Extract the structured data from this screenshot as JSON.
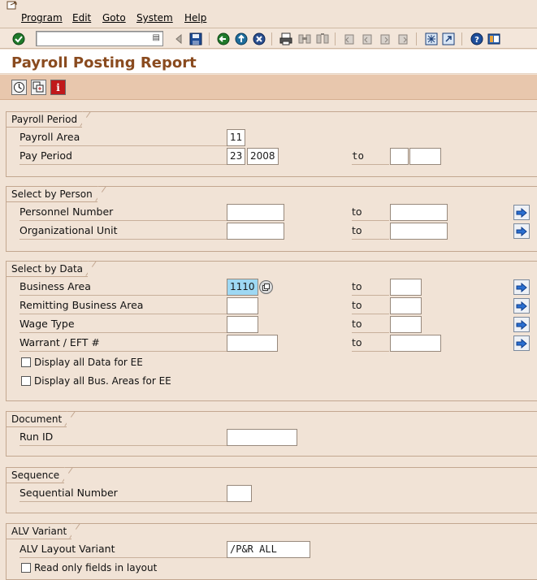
{
  "menu": [
    "Program",
    "Edit",
    "Goto",
    "System",
    "Help"
  ],
  "toolbar": {
    "command_field_value": "",
    "icons": [
      "enter-icon",
      "back-icon",
      "save-icon",
      "back-green-icon",
      "exit-icon",
      "cancel-icon",
      "print-icon",
      "find-icon",
      "find-next-icon",
      "first-page-icon",
      "prev-page-icon",
      "next-page-icon",
      "last-page-icon",
      "create-session-icon",
      "shortcut-icon",
      "help-icon",
      "layout-icon"
    ]
  },
  "page_title": "Payroll Posting Report",
  "app_toolbar": {
    "icons": [
      "execute-icon",
      "get-variant-icon",
      "info-icon"
    ]
  },
  "groups": {
    "payroll_period": {
      "title": "Payroll Period",
      "payroll_area_label": "Payroll Area",
      "payroll_area_value": "11",
      "pay_period_label": "Pay Period",
      "pay_period_value": "23",
      "pay_year_value": "2008",
      "to_label": "to",
      "to_period_value": "",
      "to_year_value": ""
    },
    "select_by_person": {
      "title": "Select by Person",
      "personnel_number_label": "Personnel Number",
      "personnel_number_from": "",
      "personnel_number_to": "",
      "org_unit_label": "Organizational Unit",
      "org_unit_from": "",
      "org_unit_to": "",
      "to_label": "to"
    },
    "select_by_data": {
      "title": "Select by Data",
      "business_area_label": "Business Area",
      "business_area_from": "1110",
      "business_area_to": "",
      "remitting_label": "Remitting Business Area",
      "remitting_from": "",
      "remitting_to": "",
      "wage_type_label": "Wage Type",
      "wage_type_from": "",
      "wage_type_to": "",
      "warrant_label": "Warrant / EFT #",
      "warrant_from": "",
      "warrant_to": "",
      "to_label": "to",
      "display_all_ee_label": "Display all Data for EE",
      "display_all_ee_checked": false,
      "display_bus_areas_label": "Display all Bus. Areas for EE",
      "display_bus_areas_checked": false
    },
    "document": {
      "title": "Document",
      "run_id_label": "Run ID",
      "run_id_value": ""
    },
    "sequence": {
      "title": "Sequence",
      "seq_label": "Sequential Number",
      "seq_value": ""
    },
    "alv_variant": {
      "title": "ALV Variant",
      "layout_label": "ALV Layout Variant",
      "layout_value": "/P&R ALL",
      "readonly_label": "Read only fields in layout",
      "readonly_checked": false
    }
  },
  "colors": {
    "background": "#f1e3d6",
    "title_color": "#8a4b1f",
    "app_toolbar": "#e8c7ad",
    "highlight_field": "#9ed8f3"
  }
}
